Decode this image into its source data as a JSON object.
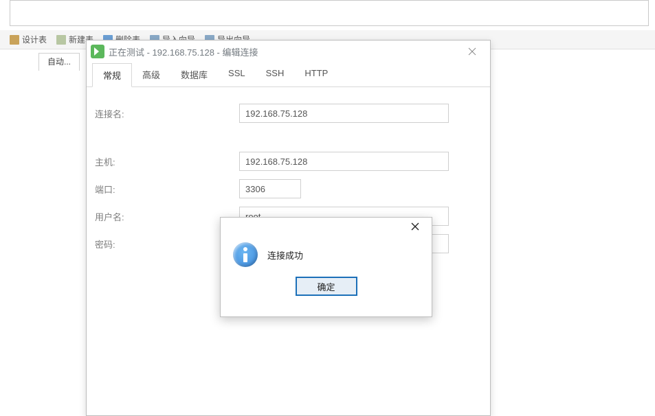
{
  "toolbar_top": {
    "design_table": "设计表",
    "new_table": "新建表",
    "delete_table": "删除表",
    "import_wizard": "导入向导",
    "export_wizard": "导出向导"
  },
  "left_tab_label": "自动...",
  "dialog": {
    "title": "正在测试 - 192.168.75.128 - 编辑连接",
    "tabs": {
      "general": "常规",
      "advanced": "高级",
      "database": "数据库",
      "ssl": "SSL",
      "ssh": "SSH",
      "http": "HTTP"
    },
    "labels": {
      "conn_name": "连接名:",
      "host": "主机:",
      "port": "端口:",
      "user": "用户名:",
      "password": "密码:"
    },
    "values": {
      "conn_name": "192.168.75.128",
      "host": "192.168.75.128",
      "port": "3306",
      "user": "root",
      "password": "•••••••••"
    }
  },
  "msgbox": {
    "text": "连接成功",
    "ok": "确定"
  }
}
